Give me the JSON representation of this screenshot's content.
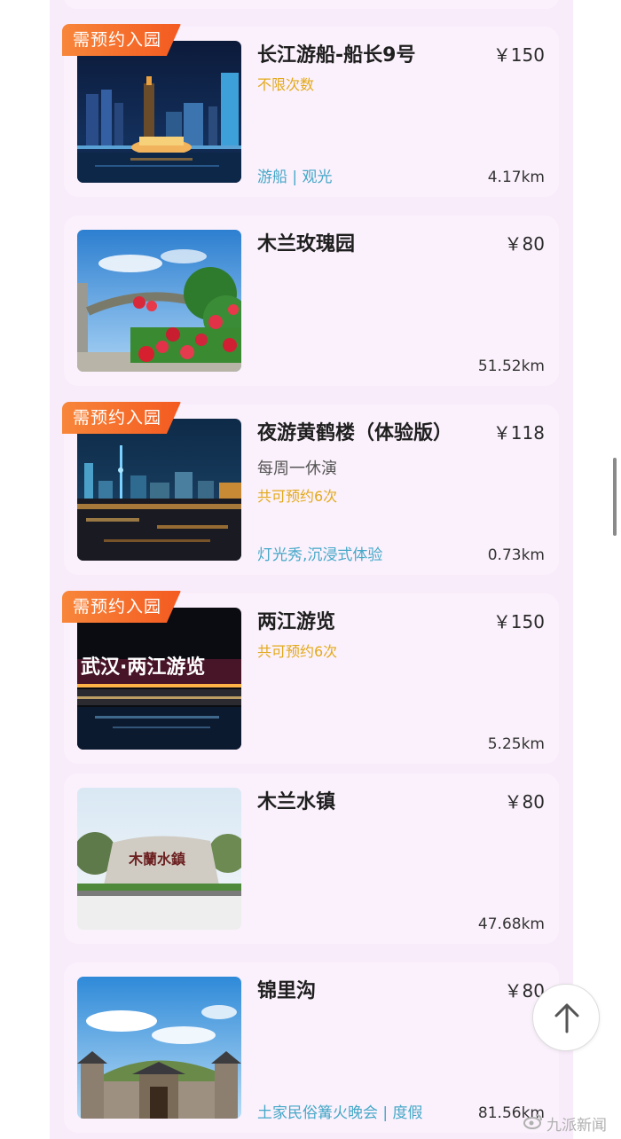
{
  "items": [
    {
      "title": "长江游船-船长9号",
      "price": "￥150",
      "badge": "需预约入园",
      "subtitle": "",
      "note": "不限次数",
      "tags": "游船 | 观光",
      "distance": "4.17km",
      "thumb": "night-river-skyline-photo"
    },
    {
      "title": "木兰玫瑰园",
      "price": "￥80",
      "badge": "",
      "subtitle": "",
      "note": "",
      "tags": "",
      "distance": "51.52km",
      "thumb": "rose-garden-arch-photo"
    },
    {
      "title": "夜游黄鹤楼（体验版）",
      "price": "￥118",
      "badge": "需预约入园",
      "subtitle": "每周一休演",
      "note": "共可预约6次",
      "tags": "灯光秀,沉浸式体验",
      "distance": "0.73km",
      "thumb": "night-city-tower-photo"
    },
    {
      "title": "两江游览",
      "price": "￥150",
      "badge": "需预约入园",
      "subtitle": "",
      "note": "共可预约6次",
      "tags": "",
      "distance": "5.25km",
      "thumb": "neon-bridge-sign-photo",
      "sign_text": "武汉·两江游览"
    },
    {
      "title": "木兰水镇",
      "price": "￥80",
      "badge": "",
      "subtitle": "",
      "note": "",
      "tags": "",
      "distance": "47.68km",
      "thumb": "stone-monument-photo",
      "sign_text": "木蘭水鎮"
    },
    {
      "title": "锦里沟",
      "price": "￥80",
      "badge": "",
      "subtitle": "",
      "note": "",
      "tags": "土家民俗篝火晚会 | 度假",
      "distance": "81.56km",
      "thumb": "traditional-gate-photo"
    }
  ],
  "back_to_top": "up-arrow-icon",
  "watermark": {
    "logo": "weibo-logo-icon",
    "text": "九派新闻"
  },
  "colors": {
    "panel_bg": "#f8ecfa",
    "card_bg": "#fbf1fc",
    "badge": "#f45a20",
    "note_gold": "#e3a91a",
    "tag_blue": "#45a8c8"
  }
}
